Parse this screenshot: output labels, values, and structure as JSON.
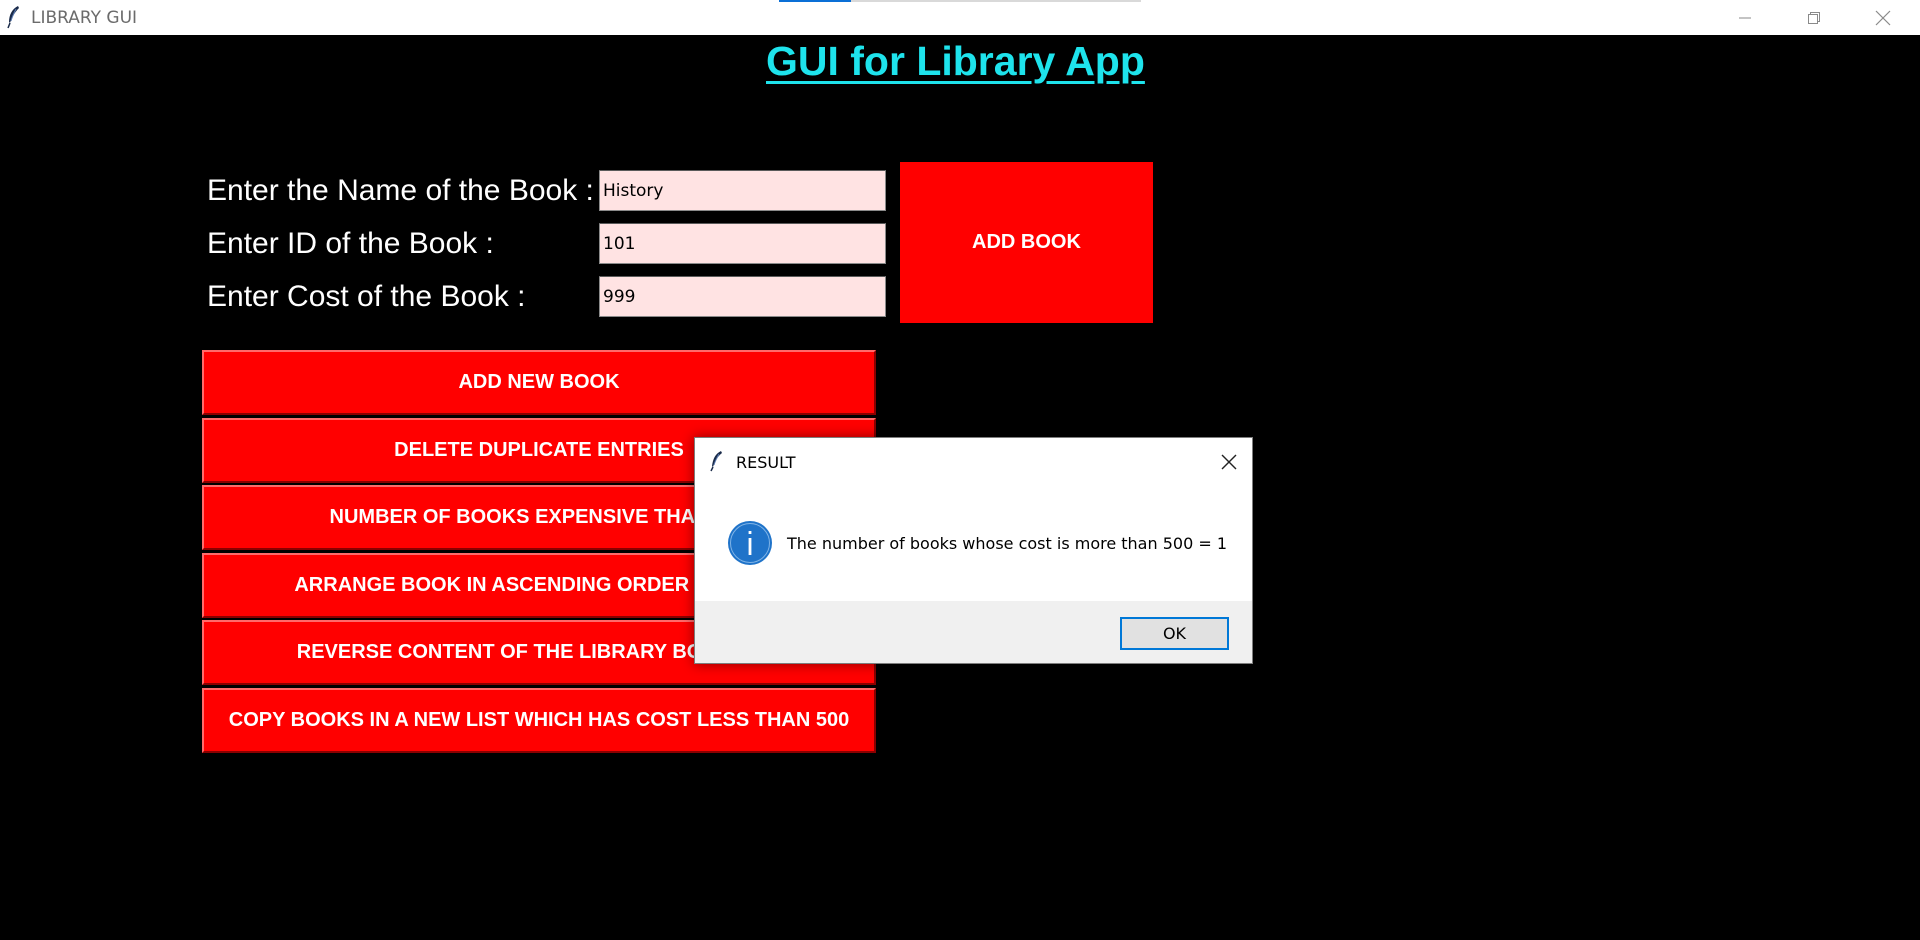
{
  "window": {
    "title": "LIBRARY GUI",
    "progress": 0.2,
    "progress_color": "#0a6fd6"
  },
  "app": {
    "title": "GUI for Library App",
    "title_color": "#1ee3ec",
    "button_color": "#ff0000"
  },
  "form": {
    "name_label": "Enter the Name of the Book :",
    "name_value": "History",
    "id_label": "Enter ID of the Book :",
    "id_value": "101",
    "cost_label": "Enter Cost of the Book :",
    "cost_value": "999",
    "add_book_label": "ADD BOOK"
  },
  "menu": {
    "items": [
      {
        "label": "ADD NEW BOOK"
      },
      {
        "label": "DELETE DUPLICATE ENTRIES"
      },
      {
        "label": "NUMBER OF BOOKS EXPENSIVE THAN 500"
      },
      {
        "label": "ARRANGE BOOK IN ASCENDING ORDER OF COST"
      },
      {
        "label": "REVERSE CONTENT OF THE LIBRARY BOOK LIST"
      },
      {
        "label": "COPY BOOKS IN A NEW LIST WHICH HAS COST LESS THAN 500"
      }
    ]
  },
  "dialog": {
    "title": "RESULT",
    "message": "The number of books whose cost is more than 500 = 1",
    "ok_label": "OK",
    "icon": "info-icon"
  },
  "icons": {
    "app": "feather-icon",
    "minimize": "minimize-icon",
    "maximize": "restore-icon",
    "close": "close-icon"
  }
}
